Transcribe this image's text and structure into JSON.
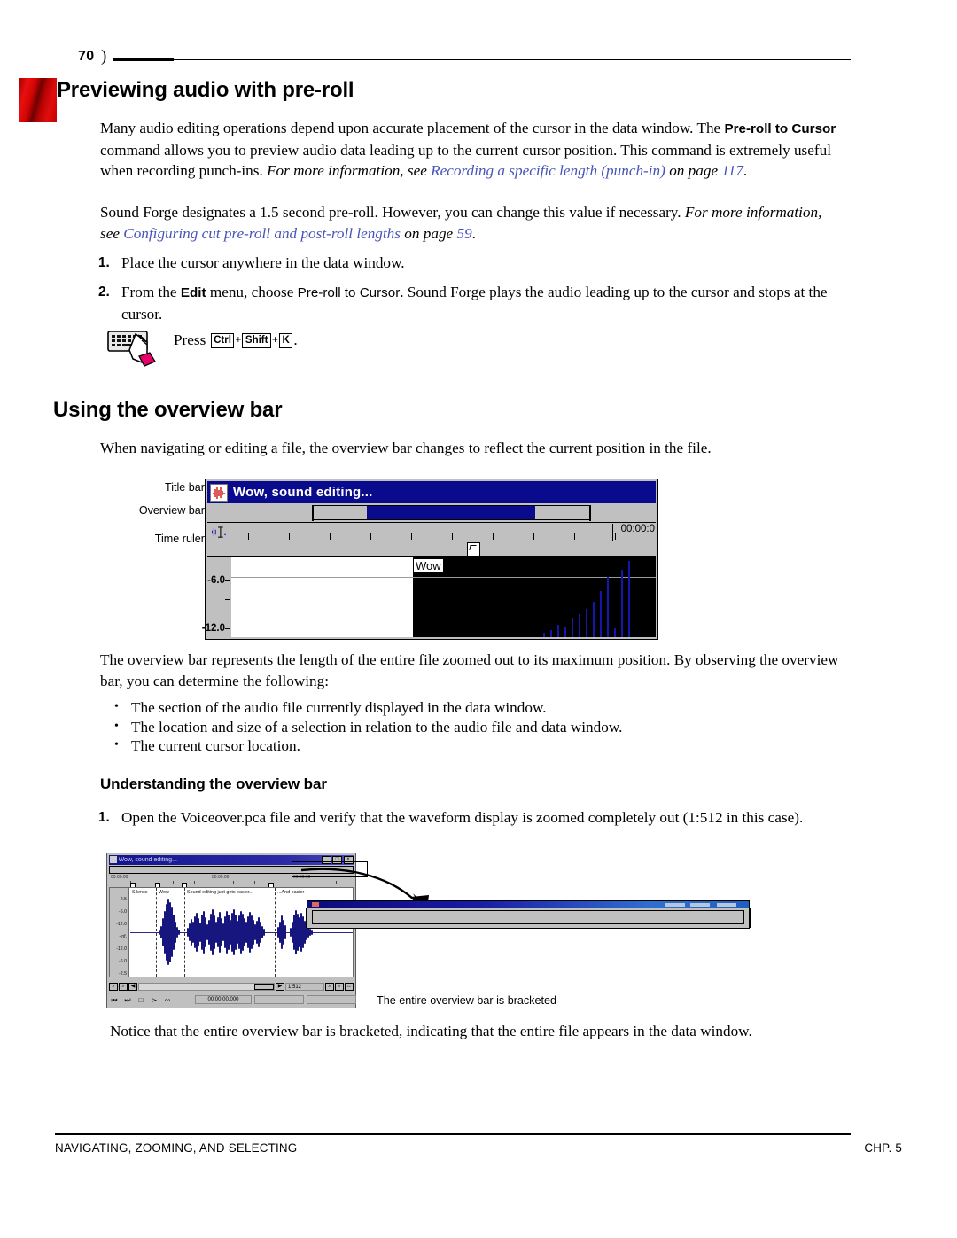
{
  "page": {
    "number": "70",
    "footer_left": "NAVIGATING, ZOOMING, AND SELECTING",
    "footer_right": "CHP. 5"
  },
  "headings": {
    "preview": "Previewing audio with pre-roll",
    "overview": "Using the overview bar",
    "understanding": "Understanding the overview bar"
  },
  "paragraphs": {
    "p1_a": "Many audio editing operations depend upon accurate placement of the cursor in the data window. The ",
    "p1_ui1": "Pre-roll to Cursor",
    "p1_b": " command allows you to preview audio data leading up to the current cursor position. This command is extremely useful when recording punch-ins. ",
    "p1_it": "For more information, see ",
    "p1_xref": "Recording a specific length (punch-in)",
    "p1_it2": " on page ",
    "p1_page": "117",
    "p1_end": ".",
    "p2_a": "Sound Forge designates a 1.5 second pre-roll. However, you can change this value if necessary. ",
    "p2_it": "For more information, see ",
    "p2_xref": "Configuring cut pre-roll and post-roll lengths",
    "p2_it2": " on page ",
    "p2_page": "59",
    "p2_end": ".",
    "p3": "The overview bar represents the length of the entire file zoomed out to its maximum position. By observing the overview bar, you can determine the following:",
    "p4": "Notice that the entire overview bar is bracketed, indicating that the entire file appears in the data window.",
    "intro_overview": "When navigating or editing a file, the overview bar changes to reflect the current position in the file."
  },
  "steps_preroll": [
    {
      "num": "1.",
      "text": "Place the cursor anywhere in the data window."
    },
    {
      "num": "2.",
      "text_a": "From the ",
      "menu": "Edit",
      "text_b": " menu, choose ",
      "command": "Pre-roll to Cursor",
      "text_c": ". Sound Forge plays the audio leading up to the cursor and stops at the cursor."
    }
  ],
  "tip": {
    "icon": "keyboard-icon",
    "press_label": "Press",
    "keys": [
      "Ctrl",
      "Shift",
      "K"
    ],
    "separator": "+",
    "period": "."
  },
  "bullets": [
    "The section of the audio file currently displayed in the data window.",
    "The location and size of a selection in relation to the audio file and data window.",
    "The current cursor location."
  ],
  "steps_understanding": [
    {
      "num": "1.",
      "text": "Open the Voiceover.pca file and verify that the waveform display is zoomed completely out (1:512 in this case)."
    }
  ],
  "figure1": {
    "labels": {
      "title_bar": "Title bar",
      "overview_bar": "Overview bar",
      "time_ruler": "Time ruler"
    },
    "window": {
      "title": "Wow, sound editing...",
      "title_icon": "waveform-document-icon",
      "tool_icon": "edit-tool-icon",
      "ruler_time": "00:00:0",
      "db_labels": [
        "-6.0",
        "-12.0"
      ],
      "waveform_tip": "Wow",
      "marker_icon": "marker-flag-icon"
    }
  },
  "figure2": {
    "caption": "The entire overview bar is bracketed",
    "window": {
      "title": "Wow, sound editing...",
      "title_icon": "waveform-document-icon",
      "buttons": [
        "_",
        "□",
        "×"
      ],
      "ruler_labels": [
        "00:00:00",
        "00:00:06",
        "00:00:09"
      ],
      "region_labels": [
        "Silence",
        "Wow",
        "Sound editing just gets easier...",
        "...And easier"
      ],
      "db_labels": [
        "-2.5",
        "-6.0",
        "-12.0",
        "-inf.",
        "-12.0",
        "-6.0",
        "-2.5"
      ],
      "zoom_ratio": "1:512",
      "cursor_position": "00:00:00.000",
      "scroll_left_icon": "scroll-left-icon",
      "scroll_right_icon": "scroll-right-icon",
      "zoom_out_icon": "zoom-out-icon",
      "zoom_in_icon": "zoom-in-icon",
      "transport_icons": [
        "go-to-start-icon",
        "go-to-end-icon",
        "stop-icon",
        "play-icon",
        "loop-icon"
      ]
    },
    "callout": {
      "magnifier_icon": "magnified-overview-bar",
      "arrow_icon": "curved-arrow-icon"
    }
  },
  "colors": {
    "xref_link": "#4753b8",
    "title_bar": "#0a0a8c",
    "chrome": "#c0c0c0",
    "waveform": "#16167e",
    "tab_red": "#d40404"
  }
}
